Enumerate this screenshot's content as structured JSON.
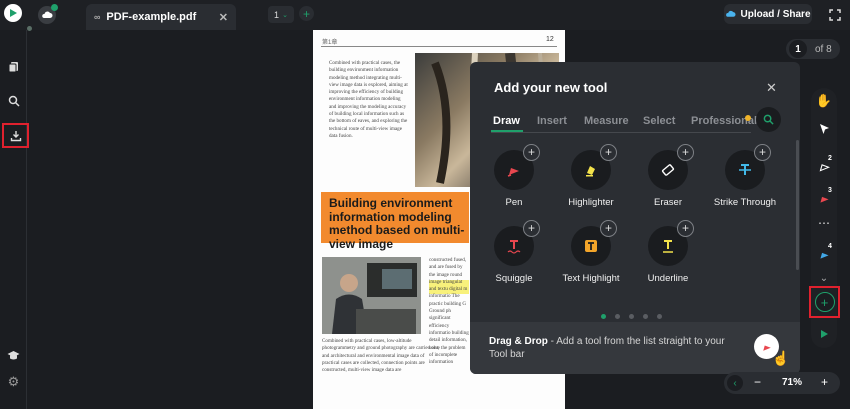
{
  "top_bar": {
    "tab_title": "PDF-example.pdf",
    "page_select": "1",
    "upload_label": "Upload / Share"
  },
  "document": {
    "header_left": "第1章",
    "header_right": "12",
    "col1_text": "Combined with practical cases, the building environment information modeling method integrating multi-view image data is explored, aiming at improving the efficiency of building environment information modeling and improving the modeling accuracy of building local information such as the bottom of eaves, and exploring the technical route of multi-view image data fusion.",
    "orange_heading": "Building environment information modeling method based on multi-view image",
    "bottom_text": "Combined with practical cases, low-altitude photogrammetry and ground photography are carried out, and architectural and environmental image data of practical cases are collected, connection points are constructed, multi-view image data are",
    "right_col_text": "constructed fused, and are fused by the image round image triangulat and textu digital m informatio The practic building G Ground ph significant efficiency informatio building detail information, solve the problem of incomplete information"
  },
  "modal": {
    "title": "Add your new tool",
    "tabs": [
      "Draw",
      "Insert",
      "Measure",
      "Select",
      "Professional"
    ],
    "active_tab": "Draw",
    "tools": [
      {
        "label": "Pen",
        "icon": "pen-icon",
        "color": "#e8474f"
      },
      {
        "label": "Highlighter",
        "icon": "highlighter-icon",
        "color": "#f3e24b"
      },
      {
        "label": "Eraser",
        "icon": "eraser-icon",
        "color": "#ffffff"
      },
      {
        "label": "Strike Through",
        "icon": "strikethrough-icon",
        "color": "#42b9e8"
      },
      {
        "label": "Squiggle",
        "icon": "squiggle-icon",
        "color": "#e8474f"
      },
      {
        "label": "Text Highlight",
        "icon": "text-highlight-icon",
        "color": "#f3a52a"
      },
      {
        "label": "Underline",
        "icon": "underline-icon",
        "color": "#f3e24b"
      }
    ],
    "footer_bold": "Drag & Drop",
    "footer_text": " - Add a tool from the list straight to your Tool bar"
  },
  "right_toolbar": {
    "badges": [
      "2",
      "3",
      "4"
    ]
  },
  "page_indicator": {
    "current": "1",
    "total_text": "of 8"
  },
  "zoom": {
    "level": "71%"
  },
  "colors": {
    "accent": "#1fa06b",
    "highlight_red": "#e0212e"
  }
}
